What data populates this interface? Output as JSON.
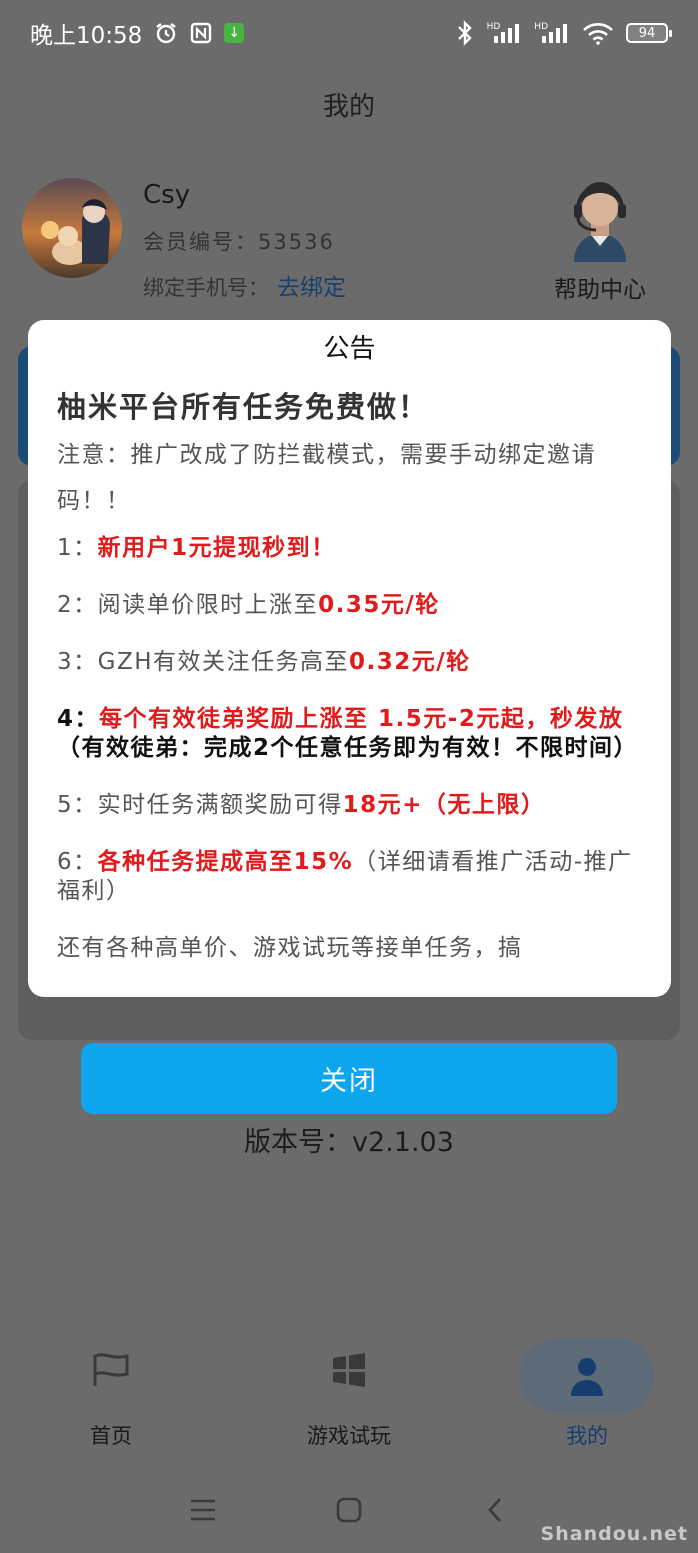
{
  "status_bar": {
    "time": "晚上10:58",
    "battery": "94",
    "hd1": "HD",
    "hd2": "HD"
  },
  "header": {
    "title": "我的"
  },
  "profile": {
    "name": "Csy",
    "member_label": "会员编号：",
    "member_id": "53536",
    "phone_label": "绑定手机号：",
    "bind_link": "去绑定"
  },
  "help_center": {
    "label": "帮助中心"
  },
  "announcement": {
    "title": "公告",
    "headline": "柚米平台所有任务免费做！",
    "notice": "注意：推广改成了防拦截模式，需要手动绑定邀请码！！",
    "items": {
      "i1_prefix": "1：",
      "i1_red": "新用户1元提现秒到！",
      "i2_prefix": "2：阅读单价限时上涨至",
      "i2_red": "0.35元/轮",
      "i3_prefix": "3：GZH有效关注任务高至",
      "i3_red": "0.32元/轮",
      "i4_prefix": "4：",
      "i4_red": "每个有效徒弟奖励上涨至 1.5元-2元起，秒发放",
      "i4_note": "（有效徒弟：完成2个任意任务即为有效！不限时间）",
      "i5_prefix": "5：实时任务满额奖励可得",
      "i5_red": "18元+（无上限）",
      "i6_prefix": "6：",
      "i6_red": "各种任务提成高至15%",
      "i6_suffix": "（详细请看推广活动-推广福利）",
      "more": "还有各种高单价、游戏试玩等接单任务，搞"
    },
    "close_label": "关闭"
  },
  "version": "版本号：v2.1.03",
  "bottom_nav": {
    "home": "首页",
    "game": "游戏试玩",
    "mine": "我的"
  },
  "watermark": "Shandou.net",
  "colors": {
    "accent_blue": "#0ea5ef",
    "highlight_red": "#e11b1b",
    "link_blue": "#17406e"
  }
}
